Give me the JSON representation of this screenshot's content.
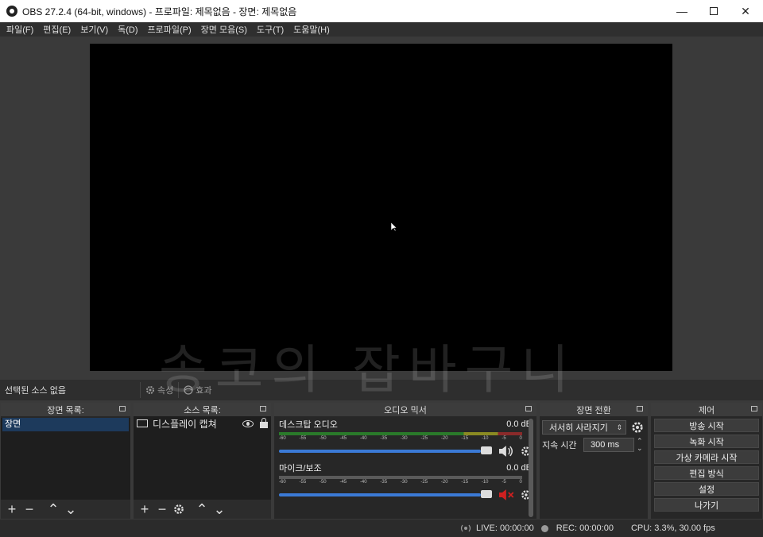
{
  "window": {
    "title": "OBS 27.2.4 (64-bit, windows) - 프로파일: 제목없음 - 장면: 제목없음",
    "minimize": "—",
    "close": "✕"
  },
  "menu": [
    "파일(F)",
    "편집(E)",
    "보기(V)",
    "독(D)",
    "프로파일(P)",
    "장면 모음(S)",
    "도구(T)",
    "도움말(H)"
  ],
  "watermark": "송코의 잡바구니",
  "source_bar": {
    "selected": "선택된 소스 없음",
    "properties": "속성",
    "filters": "효과"
  },
  "scenes": {
    "title": "장면 목록:",
    "items": [
      "장면"
    ]
  },
  "sources": {
    "title": "소스 목록:",
    "items": [
      "디스플레이 캡쳐"
    ]
  },
  "mixer": {
    "title": "오디오 믹서",
    "ticks": [
      "-60",
      "-55",
      "-50",
      "-45",
      "-40",
      "-35",
      "-30",
      "-25",
      "-20",
      "-15",
      "-10",
      "-5",
      "0"
    ],
    "channels": [
      {
        "name": "데스크탑 오디오",
        "level": "0.0 dB",
        "muted": false
      },
      {
        "name": "마이크/보조",
        "level": "0.0 dB",
        "muted": true
      }
    ]
  },
  "transitions": {
    "title": "장면 전환",
    "selected": "서서히 사라지기",
    "duration_label": "지속 시간",
    "duration_value": "300 ms"
  },
  "controls": {
    "title": "제어",
    "buttons": [
      "방송 시작",
      "녹화 시작",
      "가상 카메라 시작",
      "편집 방식",
      "설정",
      "나가기"
    ]
  },
  "status": {
    "live": "LIVE: 00:00:00",
    "rec": "REC: 00:00:00",
    "cpu": "CPU: 3.3%, 30.00 fps"
  },
  "colors": {
    "accent": "#3b7ad6",
    "mute": "#d02020",
    "selection": "#1d3a5c"
  }
}
